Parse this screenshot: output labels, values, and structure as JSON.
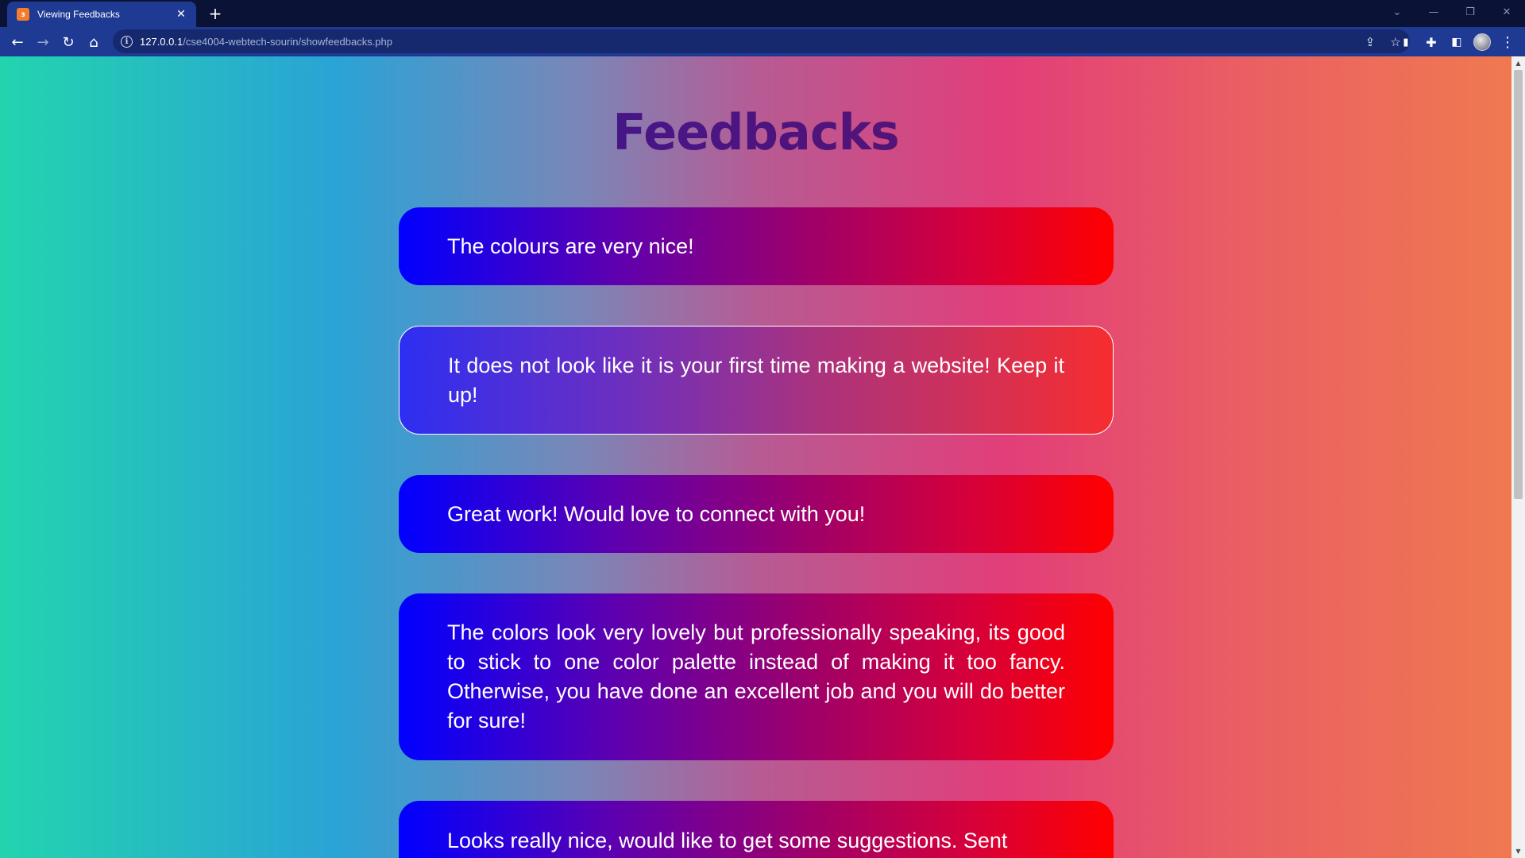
{
  "browser": {
    "tab_title": "Viewing Feedbacks",
    "tab_favicon": "xampp-icon",
    "url_host": "127.0.0.1",
    "url_path": "/cse4004-webtech-sourin/showfeedbacks.php"
  },
  "page": {
    "title": "Feedbacks",
    "feedbacks": [
      {
        "text": "The colours are very nice!"
      },
      {
        "text": "It does not look like it is your first time making a website! Keep it up!"
      },
      {
        "text": "Great work! Would love to connect with you!"
      },
      {
        "text": "The colors look very lovely but professionally speaking, its good to stick to one color palette instead of making it too fancy. Otherwise, you have done an excellent job and you will do better for sure!"
      },
      {
        "text": "Looks really nice, would like to get some suggestions. Sent"
      }
    ]
  },
  "colors": {
    "background_gradient": [
      "#22d4ae",
      "#2aa3d6",
      "#b85a93",
      "#e23e79",
      "#f07a50"
    ],
    "card_gradient": [
      "#0000ff",
      "#ff0000"
    ],
    "title_color": "#3a168f"
  }
}
